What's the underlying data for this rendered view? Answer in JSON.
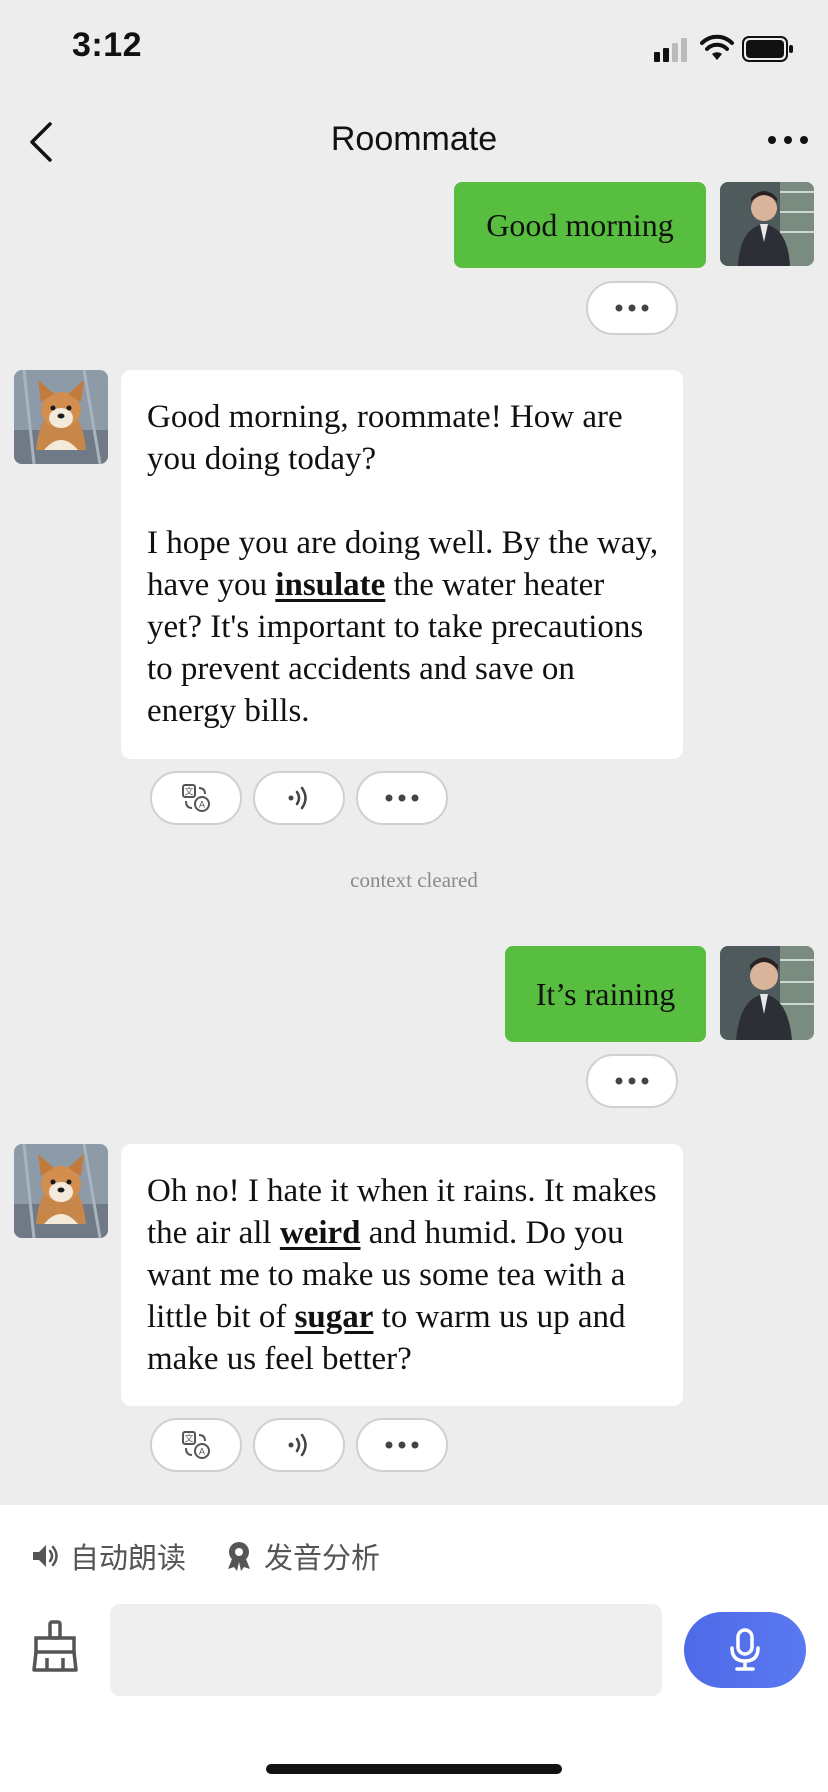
{
  "status": {
    "time": "3:12"
  },
  "nav": {
    "title": "Roommate"
  },
  "messages": {
    "m1": {
      "text": "Good morning"
    },
    "m2": {
      "p1": "Good morning, roommate! How are you doing today?",
      "p2_a": "I hope you are doing well. By the way, have you ",
      "p2_u1": "insulate",
      "p2_b": " the water heater yet? It's important to take precautions to prevent accidents and save on energy bills."
    },
    "context_note": "context cleared",
    "m3": {
      "text": "It’s raining"
    },
    "m4": {
      "a": "Oh no! I hate it when it rains. It makes the air all ",
      "u1": "weird",
      "b": " and humid. Do you want me to make us some tea with a little bit of ",
      "u2": "sugar",
      "c": " to warm us up and make us feel better?"
    }
  },
  "bottom": {
    "auto_read": "自动朗读",
    "pronunciation": "发音分析",
    "input_placeholder": ""
  },
  "icons": {
    "back": "chevron-left-icon",
    "more": "ellipsis-icon",
    "translate": "translate-icon",
    "speaker": "sound-wave-icon",
    "mic": "microphone-icon",
    "broom": "broom-icon"
  },
  "colors": {
    "user_bubble": "#58be3f",
    "mic_button": "#5472ec",
    "background": "#ededed"
  }
}
